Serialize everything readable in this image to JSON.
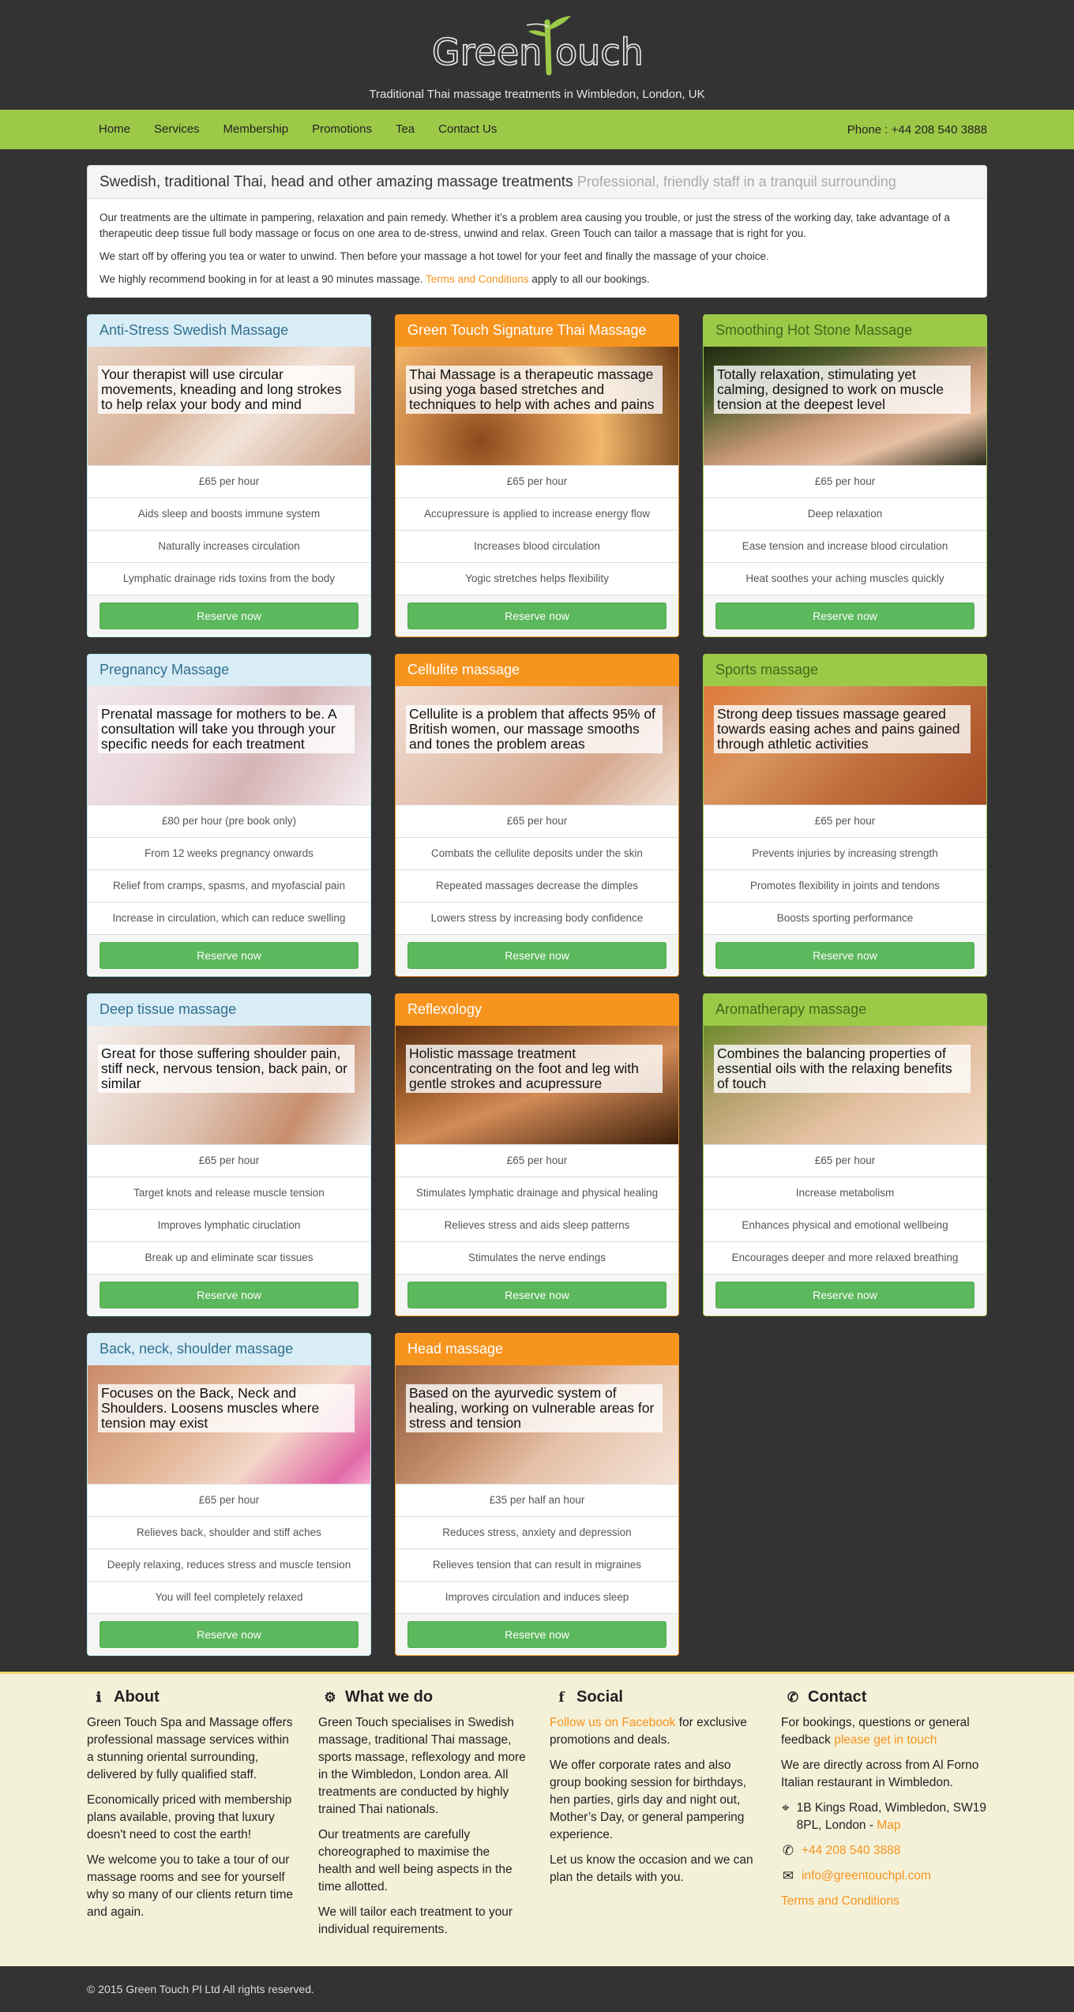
{
  "header": {
    "logo_text_left": "Green",
    "logo_text_right": "ouch",
    "tagline": "Traditional Thai massage treatments in Wimbledon, London, UK"
  },
  "nav": {
    "items": [
      "Home",
      "Services",
      "Membership",
      "Promotions",
      "Tea",
      "Contact Us"
    ],
    "phone": "Phone : +44 208 540 3888"
  },
  "intro": {
    "title": "Swedish, traditional Thai, head and other amazing massage treatments",
    "subtitle": "Professional, friendly staff in a tranquil surrounding",
    "p1": "Our treatments are the ultimate in pampering, relaxation and pain remedy. Whether it’s a problem area causing you trouble, or just the stress of the working day, take advantage of a therapeutic deep tissue full body massage or focus on one area to de-stress, unwind and relax. Green Touch can tailor a massage that is right for you.",
    "p2": "We start off by offering you tea or water to unwind. Then before your massage a hot towel for your feet and finally the massage of your choice.",
    "p3_before": "We highly recommend booking in for at least a 90 minutes massage.",
    "p3_link": "Terms and Conditions",
    "p3_after": "apply to all our bookings."
  },
  "reserve_label": "Reserve now",
  "cards": [
    {
      "title": "Anti-Stress Swedish Massage",
      "style": "blue",
      "bg": "bg-skin1",
      "caption": "Your therapist will use circular movements, kneading and long strokes to help relax your body and mind",
      "items": [
        "£65 per hour",
        "Aids sleep and boosts immune system",
        "Naturally increases circulation",
        "Lymphatic drainage rids toxins from the body"
      ]
    },
    {
      "title": "Green Touch Signature Thai Massage",
      "style": "orange",
      "bg": "bg-thai",
      "caption": "Thai Massage is a therapeutic massage using yoga based stretches and techniques to help with aches and pains",
      "items": [
        "£65 per hour",
        "Accupressure is applied to increase energy flow",
        "Increases blood circulation",
        "Yogic stretches helps flexibility"
      ]
    },
    {
      "title": "Smoothing Hot Stone Massage",
      "style": "green",
      "bg": "bg-stone",
      "caption": "Totally relaxation, stimulating yet calming, designed to work on muscle tension at the deepest level",
      "items": [
        "£65 per hour",
        "Deep relaxation",
        "Ease tension and increase blood circulation",
        "Heat soothes your aching muscles quickly"
      ]
    },
    {
      "title": "Pregnancy Massage",
      "style": "blue",
      "bg": "bg-preg",
      "caption": "Prenatal massage for mothers to be. A consultation will take you through your specific needs for each treatment",
      "items": [
        "£80 per hour (pre book only)",
        "From 12 weeks pregnancy onwards",
        "Relief from cramps, spasms, and myofascial pain",
        "Increase in circulation, which can reduce swelling"
      ]
    },
    {
      "title": "Cellulite massage",
      "style": "orange",
      "bg": "bg-cell",
      "caption": "Cellulite is a problem that affects 95% of British women, our massage smooths and tones the problem areas",
      "items": [
        "£65 per hour",
        "Combats the cellulite deposits under the skin",
        "Repeated massages decrease the dimples",
        "Lowers stress by increasing body confidence"
      ]
    },
    {
      "title": "Sports massage",
      "style": "green",
      "bg": "bg-sport",
      "caption": "Strong deep tissues massage geared towards easing aches and pains gained through athletic activities",
      "items": [
        "£65 per hour",
        "Prevents injuries by increasing strength",
        "Promotes flexibility in joints and tendons",
        "Boosts sporting performance"
      ]
    },
    {
      "title": "Deep tissue massage",
      "style": "blue",
      "bg": "bg-deep",
      "caption": "Great for those suffering shoulder pain, stiff neck, nervous tension, back pain, or similar",
      "items": [
        "£65 per hour",
        "Target knots and release muscle tension",
        "Improves lymphatic ciruclation",
        "Break up and eliminate scar tissues"
      ]
    },
    {
      "title": "Reflexology",
      "style": "orange",
      "bg": "bg-reflex",
      "caption": "Holistic massage treatment concentrating on the foot and leg with gentle strokes and acupressure",
      "items": [
        "£65 per hour",
        "Stimulates lymphatic drainage and physical healing",
        "Relieves stress and aids sleep patterns",
        "Stimulates the nerve endings"
      ]
    },
    {
      "title": "Aromatherapy massage",
      "style": "green",
      "bg": "bg-aroma",
      "caption": "Combines the balancing properties of essential oils with the relaxing benefits of touch",
      "items": [
        "£65 per hour",
        "Increase metabolism",
        "Enhances physical and emotional wellbeing",
        "Encourages deeper and more relaxed breathing"
      ]
    },
    {
      "title": "Back, neck, shoulder massage",
      "style": "blue",
      "bg": "bg-back",
      "caption": "Focuses on the Back, Neck and Shoulders. Loosens muscles where tension may exist",
      "items": [
        "£65 per hour",
        "Relieves back, shoulder and stiff aches",
        "Deeply relaxing, reduces stress and muscle tension",
        "You will feel completely relaxed"
      ]
    },
    {
      "title": "Head massage",
      "style": "orange",
      "bg": "bg-head",
      "caption": "Based on the ayurvedic system of healing, working on vulnerable areas for stress and tension",
      "items": [
        "£35 per half an hour",
        "Reduces stress, anxiety and depression",
        "Relieves tension that can result in migraines",
        "Improves circulation and induces sleep"
      ]
    }
  ],
  "footer": {
    "about": {
      "title": "About",
      "p1": "Green Touch Spa and Massage offers professional massage services within a stunning oriental surrounding, delivered by fully qualified staff.",
      "p2": "Economically priced with membership plans available, proving that luxury doesn't need to cost the earth!",
      "p3": "We welcome you to take a tour of our massage rooms and see for yourself why so many of our clients return time and again."
    },
    "whatwedo": {
      "title": "What we do",
      "p1": "Green Touch specialises in Swedish massage, traditional Thai massage, sports massage, reflexology and more in the Wimbledon, London area. All treatments are conducted by highly trained Thai nationals.",
      "p2": "Our treatments are carefully choreographed to maximise the health and well being aspects in the time allotted.",
      "p3": "We will tailor each treatment to your individual requirements."
    },
    "social": {
      "title": "Social",
      "fb_link": "Follow us on Facebook",
      "fb_after": "for exclusive promotions and deals.",
      "p2": "We offer corporate rates and also group booking session for birthdays, hen parties, girls day and night out, Mother’s Day, or general pampering experience.",
      "p3": "Let us know the occasion and we can plan the details with you."
    },
    "contact": {
      "title": "Contact",
      "p1_before": "For bookings, questions or general feedback",
      "p1_link": "please get in touch",
      "p2": "We are directly across from Al Forno Italian restaurant in Wimbledon.",
      "address": "1B Kings Road, Wimbledon, SW19 8PL, London -",
      "map_link": "Map",
      "phone": "+44 208 540 3888",
      "email": "info@greentouchpl.com",
      "terms": "Terms and Conditions"
    }
  },
  "copyright": "© 2015 Green Touch Pl Ltd All rights reserved.",
  "colors": {
    "dark_bg": "#333333",
    "nav_green": "#9cca48",
    "orange": "#f7941e",
    "button_green": "#5cb85c",
    "footer_bg": "#f4f1d9"
  }
}
